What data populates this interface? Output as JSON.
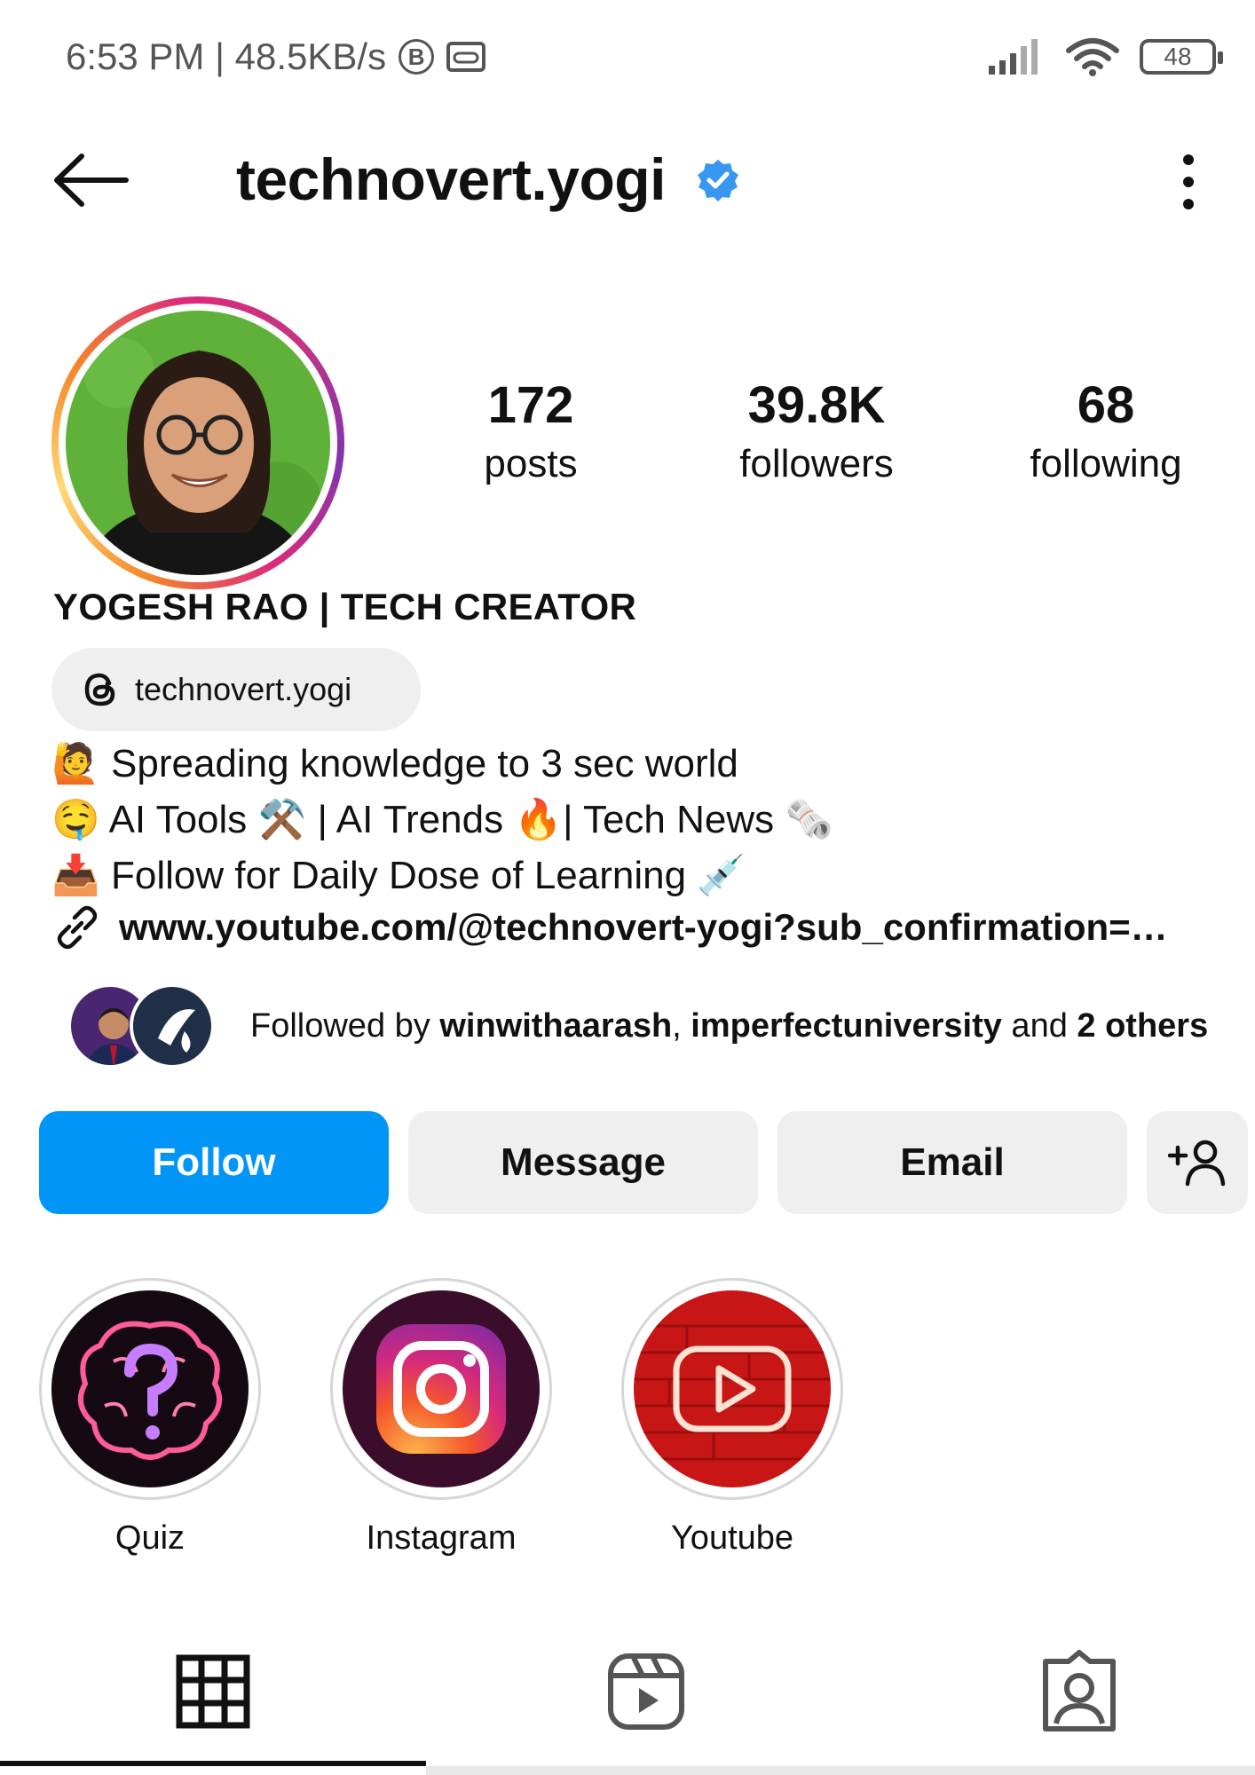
{
  "status_bar": {
    "time_speed": "6:53 PM | 48.5KB/s",
    "badge_letter": "B",
    "battery": "48"
  },
  "header": {
    "username": "technovert.yogi"
  },
  "stats": [
    {
      "value": "172",
      "label": "posts"
    },
    {
      "value": "39.8K",
      "label": "followers"
    },
    {
      "value": "68",
      "label": "following"
    }
  ],
  "profile": {
    "full_name": "YOGESH RAO | TECH CREATOR",
    "threads_handle": "technovert.yogi",
    "bio_lines": [
      "🙋 Spreading knowledge to 3 sec world",
      "🤤 AI Tools ⚒️ | AI Trends 🔥| Tech News 🗞️",
      "📥 Follow for Daily Dose of Learning 💉"
    ],
    "link": "www.youtube.com/@technovert-yogi?sub_confirmation=…"
  },
  "followed_by": {
    "prefix": "Followed by ",
    "user1": "winwithaarash",
    "separator": ", ",
    "user2": "imperfectuniversity",
    "and": " and ",
    "others": "2 others"
  },
  "actions": {
    "follow": "Follow",
    "message": "Message",
    "email": "Email"
  },
  "highlights": [
    {
      "label": "Quiz"
    },
    {
      "label": "Instagram"
    },
    {
      "label": "Youtube"
    }
  ],
  "colors": {
    "follow_blue": "#0095f6",
    "verified_blue": "#3897f0",
    "button_gray": "#efefef"
  }
}
